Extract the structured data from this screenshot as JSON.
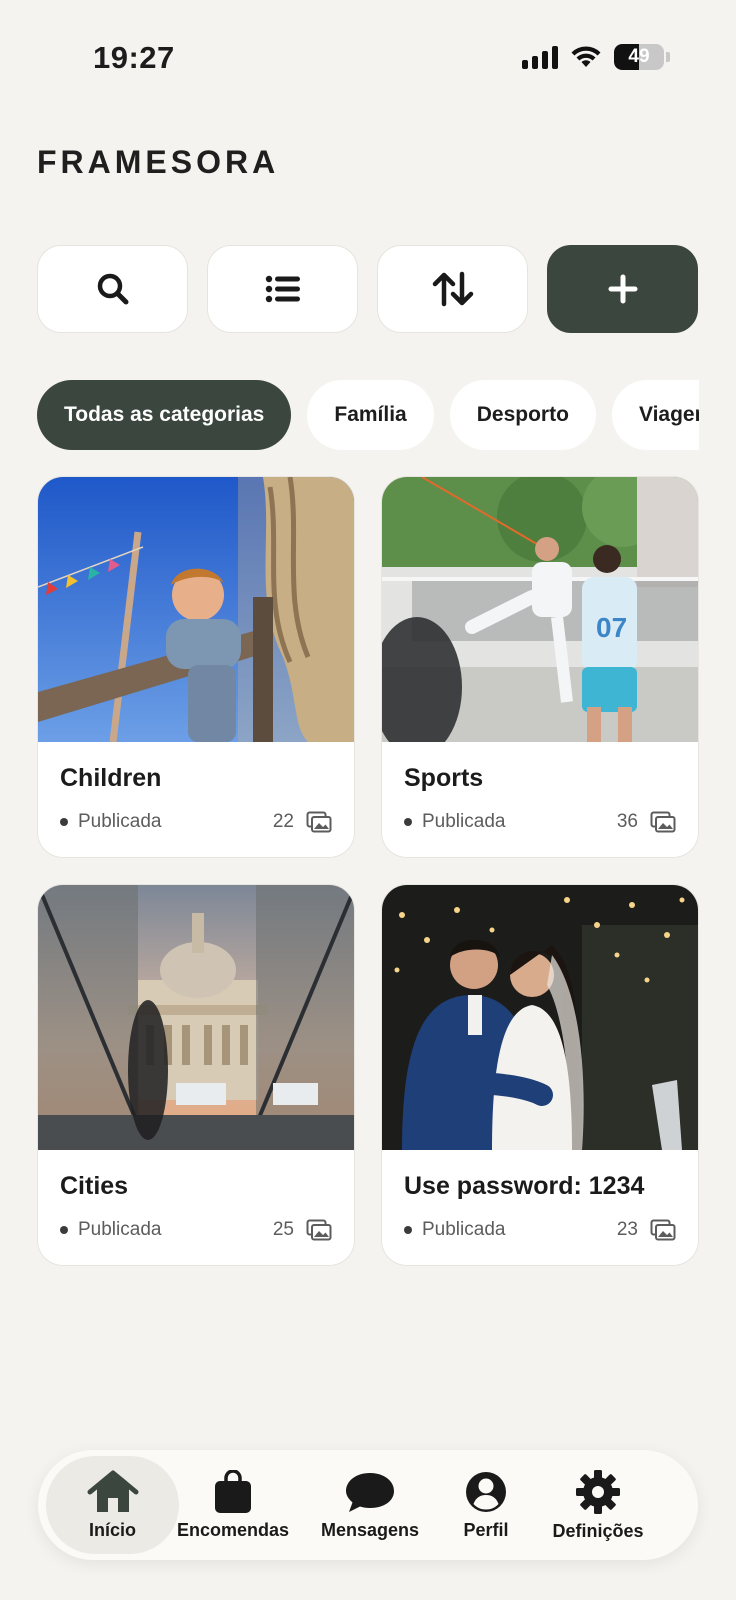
{
  "status_bar": {
    "time": "19:27",
    "battery": "49",
    "battery_level": 0.49
  },
  "brand": "FRAMESORA",
  "toolbar": {
    "search_icon": "search-icon",
    "list_icon": "list-icon",
    "sort_icon": "sort-arrows-icon",
    "add_icon": "plus-icon",
    "accent_color": "#3b463e"
  },
  "categories": [
    {
      "label": "Todas as categorias",
      "active": true
    },
    {
      "label": "Família",
      "active": false
    },
    {
      "label": "Desporto",
      "active": false
    },
    {
      "label": "Viagens",
      "active": false
    }
  ],
  "galleries": [
    {
      "title": "Children",
      "status": "Publicada",
      "count": "22",
      "image": "child climbing wooden structure with rope"
    },
    {
      "title": "Sports",
      "status": "Publicada",
      "count": "36",
      "image": "players at a footvolley net"
    },
    {
      "title": "Cities",
      "status": "Publicada",
      "count": "25",
      "image": "domed cathedral between glass walls"
    },
    {
      "title": "Use password: 1234",
      "status": "Publicada",
      "count": "23",
      "image": "couple kissing at night wedding"
    }
  ],
  "nav": {
    "items": [
      {
        "label": "Início",
        "icon": "home-icon",
        "active": true
      },
      {
        "label": "Encomendas",
        "icon": "shopping-bag-icon",
        "active": false
      },
      {
        "label": "Mensagens",
        "icon": "chat-bubble-icon",
        "active": false
      },
      {
        "label": "Perfil",
        "icon": "user-icon",
        "active": false
      },
      {
        "label": "Definições",
        "icon": "gear-icon",
        "active": false
      }
    ]
  }
}
